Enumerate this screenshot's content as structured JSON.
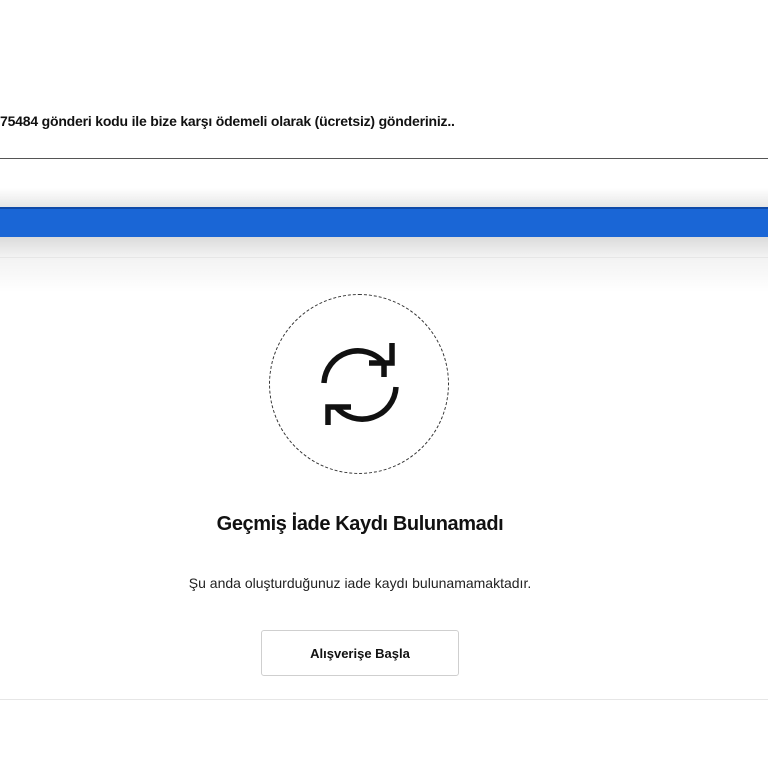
{
  "header": {
    "instruction_text": "75484 gönderi kodu ile bize karşı ödemeli olarak (ücretsiz) gönderiniz.."
  },
  "colors": {
    "accent_bar": "#1a66d6"
  },
  "empty_state": {
    "icon": "refresh-icon",
    "title": "Geçmiş İade Kaydı Bulunamadı",
    "description": "Şu anda oluşturduğunuz iade kaydı bulunamamaktadır.",
    "button_label": "Alışverişe Başla"
  }
}
